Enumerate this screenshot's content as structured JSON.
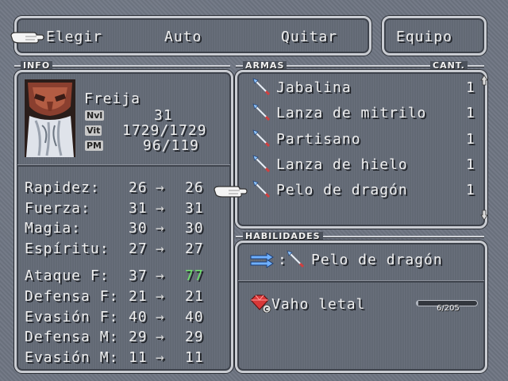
{
  "menu": {
    "elegir": "Elegir",
    "auto": "Auto",
    "quitar": "Quitar",
    "equipo": "Equipo"
  },
  "info": {
    "section": "INFO",
    "name": "Freija",
    "lvl_label": "Nvl",
    "lvl": "31",
    "vit_label": "Vit",
    "vit": "1729/1729",
    "pm_label": "PM",
    "pm": "96/119"
  },
  "stats": [
    {
      "label": "Rapidez:",
      "cur": "26",
      "new": "26"
    },
    {
      "label": "Fuerza:",
      "cur": "31",
      "new": "31"
    },
    {
      "label": "Magia:",
      "cur": "30",
      "new": "30"
    },
    {
      "label": "Espíritu:",
      "cur": "27",
      "new": "27"
    },
    {
      "label": "Ataque F:",
      "cur": "37",
      "new": "77"
    },
    {
      "label": "Defensa F:",
      "cur": "21",
      "new": "21"
    },
    {
      "label": "Evasión F:",
      "cur": "40",
      "new": "40"
    },
    {
      "label": "Defensa M:",
      "cur": "29",
      "new": "29"
    },
    {
      "label": "Evasión M:",
      "cur": "11",
      "new": "11"
    }
  ],
  "weapons": {
    "section": "ARMAS",
    "qty_header": "CANT.",
    "items": [
      {
        "name": "Jabalina",
        "qty": "1"
      },
      {
        "name": "Lanza de mitrilo",
        "qty": "1"
      },
      {
        "name": "Partisano",
        "qty": "1"
      },
      {
        "name": "Lanza de hielo",
        "qty": "1"
      },
      {
        "name": "Pelo de dragón",
        "qty": "1"
      }
    ],
    "selected_index": 4
  },
  "abilities": {
    "section": "HABILIDADES",
    "weapon_sep": ":",
    "weapon_name": "Pelo de dragón",
    "ability_name": "Vaho letal",
    "ap": "6/205",
    "ap_fraction": 0.03
  },
  "colors": {
    "stat_increase": "#6ee06a",
    "frame": "#c9ccd2",
    "panel": "#656c78"
  }
}
